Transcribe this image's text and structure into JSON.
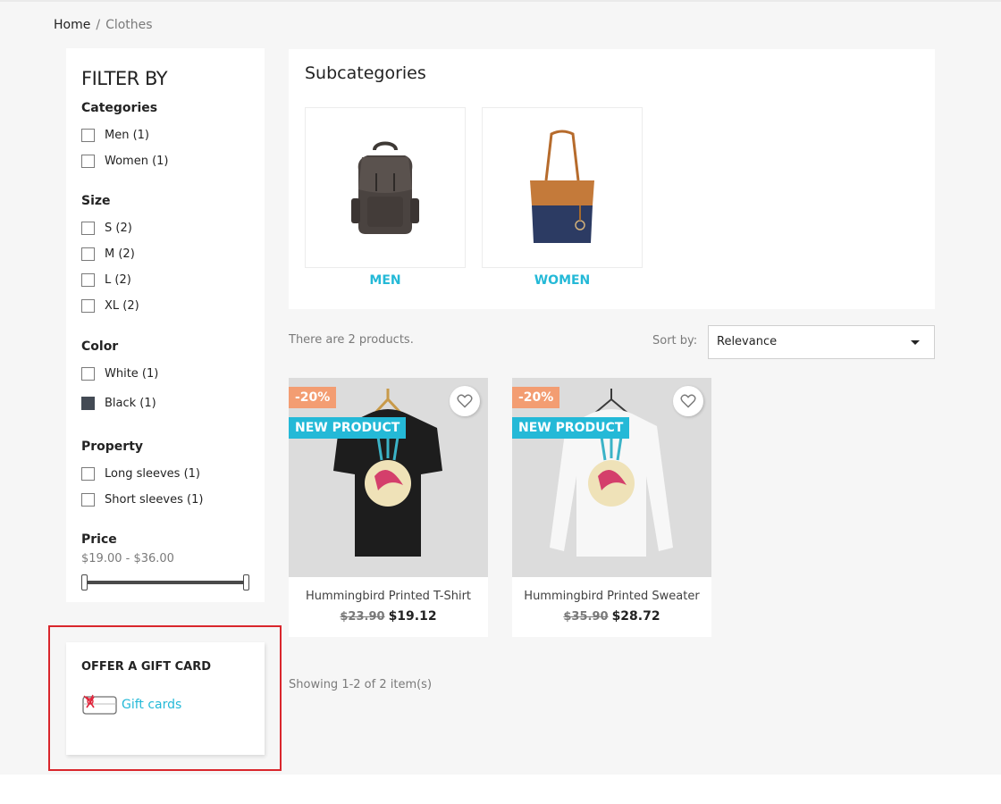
{
  "breadcrumb": {
    "home": "Home",
    "separator": "/",
    "current": "Clothes"
  },
  "filters": {
    "title": "FILTER BY",
    "categories": {
      "heading": "Categories",
      "options": [
        {
          "label": "Men (1)"
        },
        {
          "label": "Women (1)"
        }
      ]
    },
    "size": {
      "heading": "Size",
      "options": [
        {
          "label": "S (2)"
        },
        {
          "label": "M (2)"
        },
        {
          "label": "L (2)"
        },
        {
          "label": "XL (2)"
        }
      ]
    },
    "color": {
      "heading": "Color",
      "options": [
        {
          "label": "White (1)",
          "swatch": "#ffffff"
        },
        {
          "label": "Black (1)",
          "swatch": "#434a54"
        }
      ]
    },
    "property": {
      "heading": "Property",
      "options": [
        {
          "label": "Long sleeves (1)"
        },
        {
          "label": "Short sleeves (1)"
        }
      ]
    },
    "price": {
      "heading": "Price",
      "range": "$19.00 - $36.00"
    }
  },
  "gift_card": {
    "heading": "OFFER A GIFT CARD",
    "link": "Gift cards",
    "icon": "gift-card-icon"
  },
  "subcategories": {
    "heading": "Subcategories",
    "items": [
      {
        "label": "MEN",
        "image": "backpack"
      },
      {
        "label": "WOMEN",
        "image": "tote-bag"
      }
    ]
  },
  "listing": {
    "count_text": "There are 2 products.",
    "sort_label": "Sort by:",
    "sort_value": "Relevance",
    "showing_text": "Showing 1-2 of 2 item(s)"
  },
  "products": [
    {
      "discount": "-20%",
      "flag": "NEW PRODUCT",
      "name": "Hummingbird Printed T-Shirt",
      "old_price": "$23.90",
      "price": "$19.12",
      "image": "black-tshirt"
    },
    {
      "discount": "-20%",
      "flag": "NEW PRODUCT",
      "name": "Hummingbird Printed Sweater",
      "old_price": "$35.90",
      "price": "$28.72",
      "image": "white-sweater"
    }
  ],
  "colors": {
    "accent": "#24b9d7",
    "discount_badge": "#f39d72",
    "highlight": "#d9262c"
  }
}
